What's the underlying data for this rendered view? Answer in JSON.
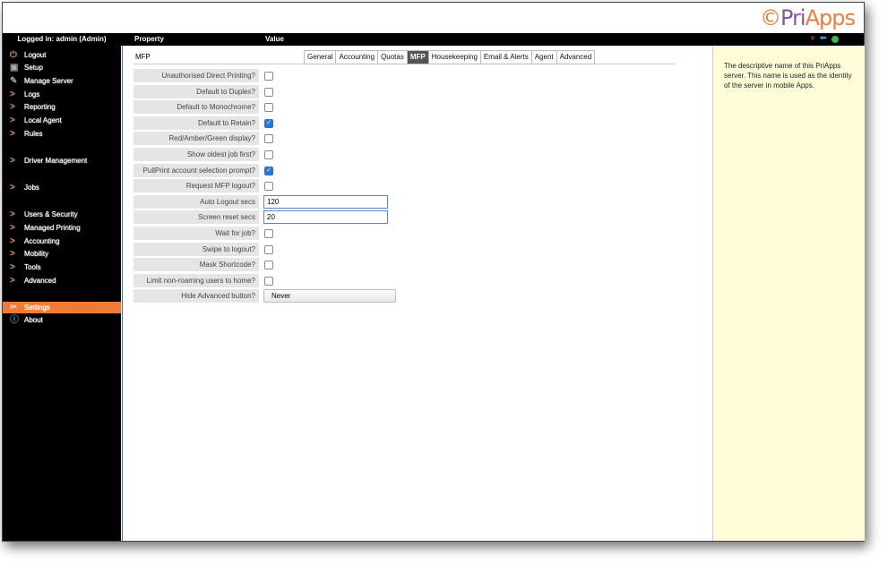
{
  "brand": {
    "logo_text": "PriApps"
  },
  "header": {
    "logged_in": "Logged in: admin (Admin)",
    "col_property": "Property",
    "col_value": "Value"
  },
  "sidebar": {
    "items": [
      {
        "label": "Logout",
        "icon": "power-icon"
      },
      {
        "label": "Setup",
        "icon": "printer-icon"
      },
      {
        "label": "Manage Server",
        "icon": "edit-icon"
      },
      {
        "label": "Logs",
        "icon": "chevron-right-icon"
      },
      {
        "label": "Reporting",
        "icon": "chevron-right-icon"
      },
      {
        "label": "Local Agent",
        "icon": "chevron-right-icon"
      },
      {
        "label": "Rules",
        "icon": "chevron-right-icon"
      },
      {
        "label": "Driver Management",
        "icon": "chevron-right-icon"
      },
      {
        "label": "Jobs",
        "icon": "chevron-right-icon"
      },
      {
        "label": "Users & Security",
        "icon": "chevron-right-icon"
      },
      {
        "label": "Managed Printing",
        "icon": "chevron-right-icon"
      },
      {
        "label": "Accounting",
        "icon": "chevron-right-icon"
      },
      {
        "label": "Mobility",
        "icon": "chevron-right-icon"
      },
      {
        "label": "Tools",
        "icon": "chevron-right-icon"
      },
      {
        "label": "Advanced",
        "icon": "chevron-right-icon"
      },
      {
        "label": "Settings",
        "icon": "tools-icon",
        "active": true
      },
      {
        "label": "About",
        "icon": "info-icon"
      }
    ]
  },
  "main": {
    "section": "MFP",
    "tabs": [
      "General",
      "Accounting",
      "Quotas",
      "MFP",
      "Housekeeping",
      "Email & Alerts",
      "Agent",
      "Advanced"
    ],
    "selected_tab": "MFP",
    "rows": [
      {
        "label": "Unauthorised Direct Printing?",
        "type": "checkbox",
        "checked": false
      },
      {
        "label": "Default to Duplex?",
        "type": "checkbox",
        "checked": false
      },
      {
        "label": "Default to Monochrome?",
        "type": "checkbox",
        "checked": false
      },
      {
        "label": "Default to Retain?",
        "type": "checkbox",
        "checked": true
      },
      {
        "label": "Red/Amber/Green display?",
        "type": "checkbox",
        "checked": false
      },
      {
        "label": "Show oldest job first?",
        "type": "checkbox",
        "checked": false
      },
      {
        "label": "PullPrint account selection prompt?",
        "type": "checkbox",
        "checked": true
      },
      {
        "label": "Request MFP logout?",
        "type": "checkbox",
        "checked": false
      },
      {
        "label": "Auto Logout secs",
        "type": "text",
        "value": "120"
      },
      {
        "label": "Screen reset secs",
        "type": "text",
        "value": "20"
      },
      {
        "label": "Wait for job?",
        "type": "checkbox",
        "checked": false
      },
      {
        "label": "Swipe to logout?",
        "type": "checkbox",
        "checked": false
      },
      {
        "label": "Mask Shortcode?",
        "type": "checkbox",
        "checked": false
      },
      {
        "label": "Limit non-roaming users to home?",
        "type": "checkbox",
        "checked": false
      },
      {
        "label": "Hide Advanced button?",
        "type": "select",
        "value": "Never"
      }
    ]
  },
  "help": {
    "text": "The descriptive name of this PriApps server. This name is used as the identity of the server in mobile Apps."
  },
  "colors": {
    "accent": "#ef7b34",
    "help_bg": "#fffcd8",
    "checkbox": "#2a74d8"
  }
}
